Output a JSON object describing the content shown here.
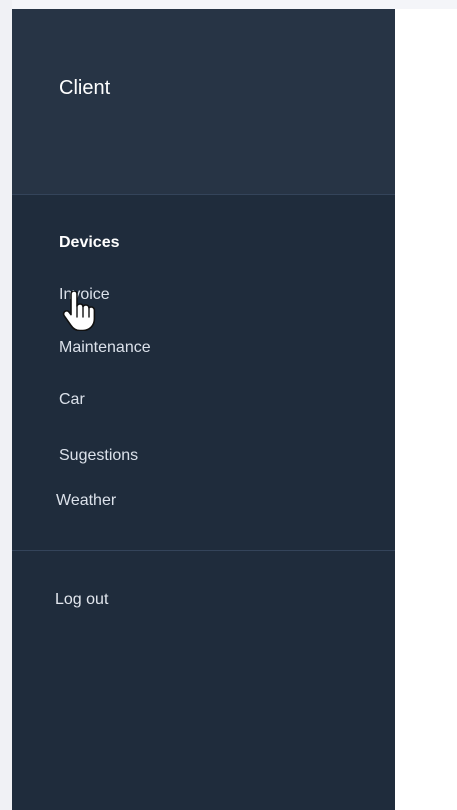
{
  "sidebar": {
    "header": {
      "title": "Client"
    },
    "menu": [
      {
        "label": "Devices",
        "active": true
      },
      {
        "label": "Invoice",
        "active": false
      },
      {
        "label": "Maintenance",
        "active": false
      },
      {
        "label": "Car",
        "active": false
      },
      {
        "label": "Sugestions",
        "active": false
      },
      {
        "label": "Weather",
        "active": false
      }
    ],
    "logout_label": "Log out"
  },
  "icons": {
    "cursor": "hand-pointer-icon"
  },
  "colors": {
    "sidebar_bg": "#1f2c3c",
    "header_bg": "#273445",
    "divider": "#34445a",
    "text": "#dbe1ea"
  }
}
